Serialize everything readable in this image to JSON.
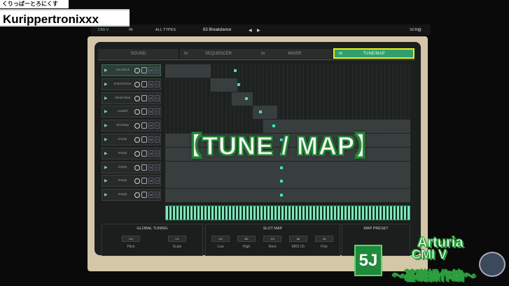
{
  "channel": {
    "small_text": "くりっぱーとろにくす",
    "name": "Kurippertronixxx"
  },
  "topbar": {
    "app_label": "CMI V",
    "module_label": "IN",
    "types_label": "ALL TYPES",
    "preset_name": "83 Breakdance",
    "prev_glyph": "◀",
    "next_glyph": "▶",
    "sc_label": "SCR",
    "gear_icon": "gear-icon"
  },
  "tabs": [
    {
      "num": "",
      "label": "SOUND"
    },
    {
      "num": "IN",
      "label": "SEQUENCER"
    },
    {
      "num": "IN",
      "label": "MIXER"
    },
    {
      "num": "IN",
      "label": "TUNE/MAP"
    }
  ],
  "slots": [
    {
      "name": "Voice/kick",
      "m": "M",
      "s": "S"
    },
    {
      "name": "Snare/Snare",
      "m": "M",
      "s": "S"
    },
    {
      "name": "Hihat/Hihat",
      "m": "M",
      "s": "S"
    },
    {
      "name": "cowbell",
      "m": "M",
      "s": "S"
    },
    {
      "name": "vibraslap",
      "m": "M",
      "s": "S"
    },
    {
      "name": "Empty",
      "m": "M",
      "s": "S"
    },
    {
      "name": "Empty",
      "m": "M",
      "s": "S"
    },
    {
      "name": "Empty",
      "m": "M",
      "s": "S"
    },
    {
      "name": "Empty",
      "m": "M",
      "s": "S"
    },
    {
      "name": "Empty",
      "m": "M",
      "s": "S"
    }
  ],
  "overlay_title": "【TUNE / MAP】",
  "global_tuning": {
    "title": "GLOBAL TUNING",
    "pitch_value": "0.0",
    "pitch_label": "Pitch",
    "scale_value": "1:1",
    "scale_label": "Scale"
  },
  "slot_map": {
    "title": "SLOT MAP",
    "fields": [
      {
        "value": "C0",
        "label": "Low"
      },
      {
        "value": "B3",
        "label": "High"
      },
      {
        "value": "C3",
        "label": "Root"
      },
      {
        "value": "All",
        "label": "MIDI Ch"
      },
      {
        "value": "16",
        "label": "Poly"
      }
    ]
  },
  "map_preset": {
    "title": "MAP PRESET"
  },
  "logos": {
    "box_text": "5J",
    "arturia": "Arturia",
    "cmi": "CMI V",
    "basic_ops": "〜基礎操作編〜"
  },
  "colors": {
    "accent": "#30a06a",
    "tab_highlight": "#e8f020",
    "frame": "#d4c7a8",
    "dot": "#3ee0c0"
  }
}
